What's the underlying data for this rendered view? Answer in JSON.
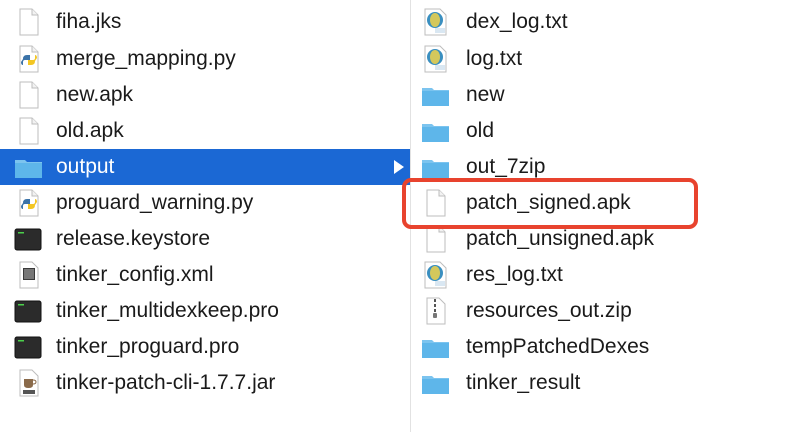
{
  "left_column": {
    "items": [
      {
        "name": "fiha.jks",
        "icon": "document-icon"
      },
      {
        "name": "merge_mapping.py",
        "icon": "python-file-icon"
      },
      {
        "name": "new.apk",
        "icon": "document-icon"
      },
      {
        "name": "old.apk",
        "icon": "document-icon"
      },
      {
        "name": "output",
        "icon": "folder-icon",
        "selected": true
      },
      {
        "name": "proguard_warning.py",
        "icon": "python-file-icon"
      },
      {
        "name": "release.keystore",
        "icon": "terminal-file-icon"
      },
      {
        "name": "tinker_config.xml",
        "icon": "xml-file-icon"
      },
      {
        "name": "tinker_multidexkeep.pro",
        "icon": "terminal-file-icon"
      },
      {
        "name": "tinker_proguard.pro",
        "icon": "terminal-file-icon"
      },
      {
        "name": "tinker-patch-cli-1.7.7.jar",
        "icon": "jar-file-icon"
      }
    ]
  },
  "right_column": {
    "items": [
      {
        "name": "dex_log.txt",
        "icon": "text-file-icon"
      },
      {
        "name": "log.txt",
        "icon": "text-file-icon"
      },
      {
        "name": "new",
        "icon": "folder-icon"
      },
      {
        "name": "old",
        "icon": "folder-icon"
      },
      {
        "name": "out_7zip",
        "icon": "folder-icon"
      },
      {
        "name": "patch_signed.apk",
        "icon": "document-icon",
        "highlighted": true
      },
      {
        "name": "patch_unsigned.apk",
        "icon": "document-icon"
      },
      {
        "name": "res_log.txt",
        "icon": "text-file-icon"
      },
      {
        "name": "resources_out.zip",
        "icon": "zip-file-icon"
      },
      {
        "name": "tempPatchedDexes",
        "icon": "folder-icon"
      },
      {
        "name": "tinker_result",
        "icon": "folder-icon"
      }
    ]
  },
  "colors": {
    "selection": "#1b68d4",
    "highlight_border": "#e8432e",
    "folder": "#5eb6ea"
  }
}
